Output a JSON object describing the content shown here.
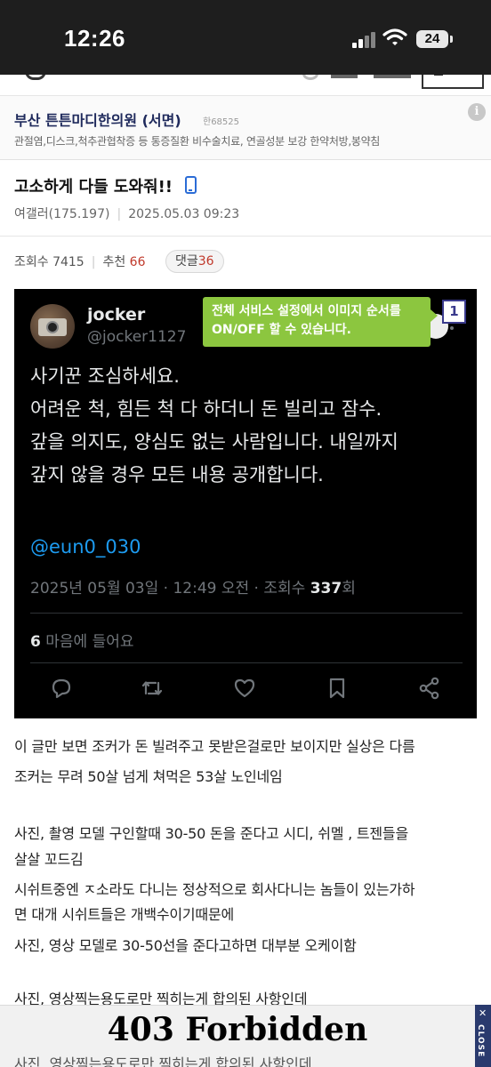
{
  "status_bar": {
    "time": "12:26",
    "battery": "24",
    "icons": [
      "cellular-signal-icon",
      "wifi-icon",
      "battery-icon"
    ]
  },
  "ad": {
    "title": "부산 튼튼마디한의원 (서면)",
    "phone": "한68525",
    "description": "관절염,디스크,척추관협착증 등 통증질환 비수술치료, 연골성분 보강 한약처방,봉약침",
    "info_icon": "i"
  },
  "post": {
    "title": "고소하게 다들 도와줘!!",
    "author": "여갤러(175.197)",
    "date": "2025.05.03 09:23",
    "views_label": "조회수 7415",
    "recommend_label": "추천",
    "recommend_count": "66",
    "comments_label": "댓글",
    "comments_count": "36"
  },
  "tweet": {
    "name": "jocker",
    "handle": "@jocker1127",
    "lines": [
      "사기꾼 조심하세요.",
      "어려운 척, 힘든 척 다 하더니 돈 빌리고 잠수.",
      "갚을 의지도, 양심도 없는 사람입니다. 내일까지",
      "갚지 않을 경우 모든 내용 공개합니다."
    ],
    "mention": "@eun0_030",
    "date_text": "2025년 05월 03일 · 12:49 오전 · 조회수",
    "views": "337",
    "views_unit": "회",
    "likes_count": "6",
    "likes_label": "마음에 들어요",
    "actions": [
      "reply-icon",
      "retweet-icon",
      "like-icon",
      "bookmark-icon",
      "share-icon"
    ]
  },
  "tooltip": {
    "line1": "전체 서비스 설정에서 이미지 순서를",
    "line2": "ON/OFF 할 수 있습니다.",
    "index": "1"
  },
  "body": {
    "lines": [
      "이 글만 보면 조커가 돈 빌려주고 못받은걸로만 보이지만 실상은 다름",
      "조커는 무려 50살 넘게 쳐먹은 53살 노인네임",
      "사진, 촬영 모델 구인할때 30-50 돈을 준다고 시디, 쉬멜 , 트젠들을",
      "살살 꼬드김",
      "시쉬트중엔 ㅈ소라도 다니는 정상적으로 회사다니는 놈들이 있는가하",
      "면 대개 시쉬트들은 개백수이기때문에",
      "사진, 영상 모델로 30-50선을 준다고하면 대부분 오케이함",
      "사진, 영상찍는용도로만 찍히는게 합의된 사항인데"
    ]
  },
  "overlay": {
    "text": "403 Forbidden",
    "close_label": "CLOSE",
    "close_x": "✕",
    "ghost_text": "사진, 영상찍는용도로만 찍히는게 합의된 사항인데"
  }
}
